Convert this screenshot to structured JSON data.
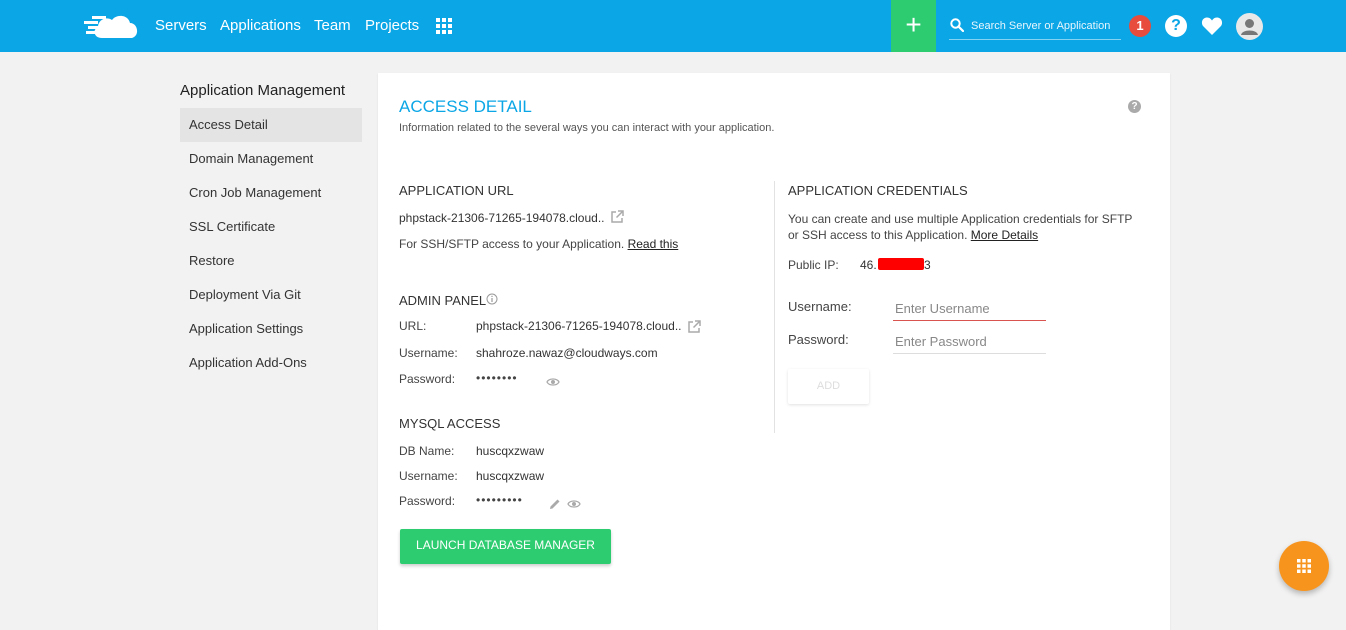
{
  "topbar": {
    "nav": [
      {
        "label": "Servers"
      },
      {
        "label": "Applications"
      },
      {
        "label": "Team"
      },
      {
        "label": "Projects"
      }
    ],
    "search_placeholder": "Search Server or Application",
    "notification_count": "1",
    "help_glyph": "?",
    "add_glyph": "+"
  },
  "sidebar": {
    "title": "Application Management",
    "items": [
      {
        "label": "Access Detail",
        "active": true
      },
      {
        "label": "Domain Management"
      },
      {
        "label": "Cron Job Management"
      },
      {
        "label": "SSL Certificate"
      },
      {
        "label": "Restore"
      },
      {
        "label": "Deployment Via Git"
      },
      {
        "label": "Application Settings"
      },
      {
        "label": "Application Add-Ons"
      }
    ]
  },
  "panel": {
    "title": "ACCESS DETAIL",
    "subtitle": "Information related to the several ways you can interact with your application.",
    "app_url": {
      "heading": "APPLICATION URL",
      "url": "phpstack-21306-71265-194078.cloud..",
      "ssh_text": "For SSH/SFTP access to your Application.",
      "ssh_link": "Read this"
    },
    "admin_panel": {
      "heading": "ADMIN PANEL",
      "url_label": "URL:",
      "url_value": "phpstack-21306-71265-194078.cloud..",
      "username_label": "Username:",
      "username_value": "shahroze.nawaz@cloudways.com",
      "password_label": "Password:",
      "password_value": "••••••••"
    },
    "mysql": {
      "heading": "MYSQL ACCESS",
      "db_label": "DB Name:",
      "db_value": "huscqxzwaw",
      "username_label": "Username:",
      "username_value": "huscqxzwaw",
      "password_label": "Password:",
      "password_value": "•••••••••"
    },
    "launch_button": "LAUNCH DATABASE MANAGER",
    "credentials": {
      "heading": "APPLICATION CREDENTIALS",
      "text_line1": "You can create and use multiple Application credentials for SFTP",
      "text_line2": "or SSH access to this Application.",
      "more_link": "More Details",
      "public_ip_label": "Public IP:",
      "public_ip_start": "46.",
      "public_ip_end": "3",
      "username_label": "Username:",
      "username_placeholder": "Enter Username",
      "password_label": "Password:",
      "password_placeholder": "Enter Password",
      "add_button": "ADD"
    }
  },
  "colors": {
    "topbar": "#0ba6e6",
    "accent_green": "#2ecc71",
    "badge_red": "#e74c3c",
    "fab_orange": "#f7941d"
  }
}
